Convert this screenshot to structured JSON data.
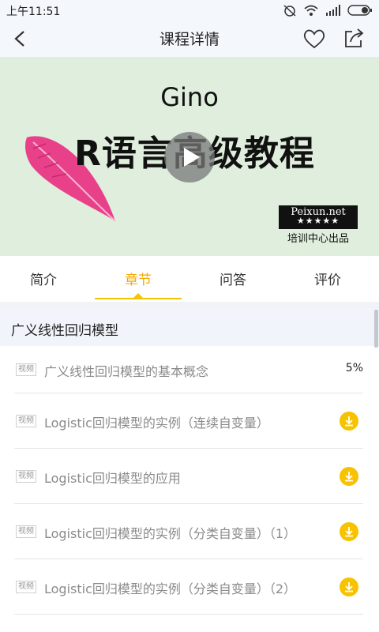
{
  "status_bar": {
    "time": "上午11:51",
    "icons": [
      "alarm-off-icon",
      "wifi-icon",
      "signal-icon",
      "battery-icon"
    ]
  },
  "nav": {
    "title": "课程详情",
    "icons": [
      "back-arrow-icon",
      "heart-icon",
      "share-icon"
    ]
  },
  "banner": {
    "author": "Gino",
    "course_title": "R语言高级教程",
    "logo_text": "Peixun.net",
    "logo_stars": "★★★★★",
    "logo_sub": "培训中心出品",
    "icons": [
      "feather-icon",
      "play-icon"
    ],
    "colors": {
      "background": "#dfeedd",
      "feather": "#e8418a"
    }
  },
  "tabs": [
    {
      "label": "简介",
      "active": false
    },
    {
      "label": "章节",
      "active": true
    },
    {
      "label": "问答",
      "active": false
    },
    {
      "label": "评价",
      "active": false
    }
  ],
  "chapter": {
    "title": "广义线性回归模型",
    "lessons": [
      {
        "tag": "视频",
        "title": "广义线性回归模型的基本概念",
        "progress": "5%"
      },
      {
        "tag": "视频",
        "title": " Logistic回归模型的实例（连续自变量）",
        "download": true
      },
      {
        "tag": "视频",
        "title": "Logistic回归模型的应用",
        "download": true
      },
      {
        "tag": "视频",
        "title": "Logistic回归模型的实例（分类自变量）（1）",
        "download": true
      },
      {
        "tag": "视频",
        "title": "Logistic回归模型的实例（分类自变量）（2）",
        "download": true
      }
    ]
  },
  "colors": {
    "accent": "#f5a800",
    "download": "#f7c300",
    "header_bg": "#f4f7fc"
  }
}
